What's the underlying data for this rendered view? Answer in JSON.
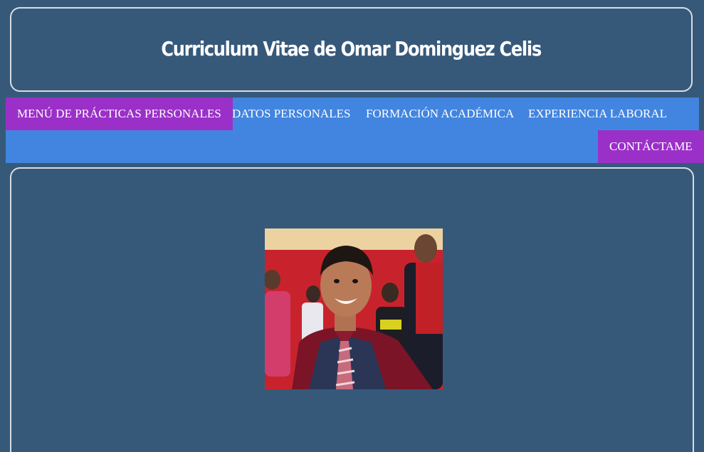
{
  "header": {
    "title": "Curriculum Vitae de Omar Dominguez Celis"
  },
  "nav": {
    "items": [
      {
        "label": "MENÚ DE PRÁCTICAS PERSONALES",
        "active": true
      },
      {
        "label": "DATOS PERSONALES",
        "active": false
      },
      {
        "label": "FORMACIÓN ACADÉMICA",
        "active": false
      },
      {
        "label": "EXPERIENCIA LABORAL",
        "active": false
      },
      {
        "label": "CONTÁCTAME",
        "active": true
      }
    ]
  },
  "content": {
    "photo": "profile-photo"
  },
  "colors": {
    "page_background": "#36597a",
    "nav_background": "#4285e0",
    "nav_active": "#9b30c8",
    "border": "#d8dde3",
    "text": "#ffffff"
  }
}
